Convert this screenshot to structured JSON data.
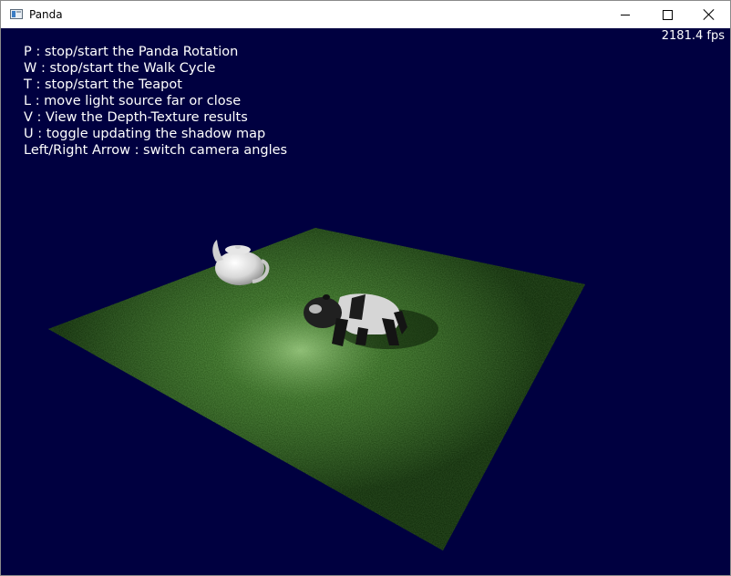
{
  "window": {
    "title": "Panda",
    "icon": "app-window-icon",
    "controls": [
      "minimize-icon",
      "maximize-icon",
      "close-icon"
    ]
  },
  "overlay": {
    "fps": "2181.4 fps",
    "instructions": [
      "P : stop/start the Panda Rotation",
      "W : stop/start the Walk Cycle",
      "T : stop/start the Teapot",
      "L : move light source far or close",
      "V : View the Depth-Texture results",
      "U : toggle updating the shadow map",
      "Left/Right Arrow : switch camera angles"
    ]
  },
  "colors": {
    "background": "#000040",
    "ground": "#2f5a1e",
    "text": "#ffffff"
  }
}
